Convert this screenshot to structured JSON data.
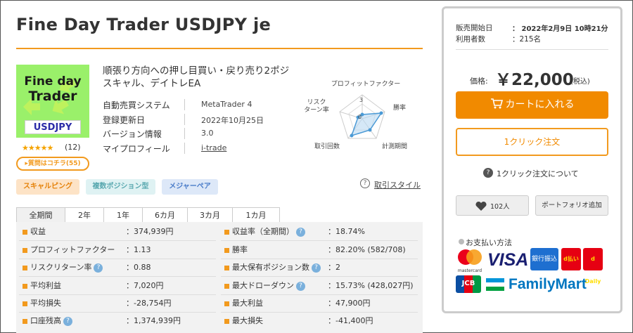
{
  "title": "Fine Day Trader USDJPY je",
  "logo": {
    "line1": "Fine day",
    "line2": "Trader",
    "badge": "USDJPY"
  },
  "rating": {
    "stars": "★★★★★",
    "count": "(12)"
  },
  "qa_button": "▸質問はコチラ(55)",
  "catchcopy": "順張り方向への押し目買い・戻り売り2ポジスキャル、デイトレEA",
  "info": [
    {
      "label": "自動売買システム",
      "value": "MetaTrader 4"
    },
    {
      "label": "登録更新日",
      "value": "2022年10月25日"
    },
    {
      "label": "バージョン情報",
      "value": "3.0"
    },
    {
      "label": "マイプロフィール",
      "value": "i-trade"
    }
  ],
  "radar": {
    "labels": {
      "top": "プロフィットファクター",
      "right_top": "勝率",
      "right_bottom": "計測期間",
      "left_bottom": "取引回数",
      "left_top": "リスク\nターン率"
    },
    "scale_top": "3",
    "scale_center": "0"
  },
  "tags": [
    {
      "label": "スキャルピング",
      "bg": "#fde3c6",
      "color": "#e5820a"
    },
    {
      "label": "複数ポジション型",
      "bg": "#dff2f3",
      "color": "#5aa9b0"
    },
    {
      "label": "メジャーペア",
      "bg": "#dde8f8",
      "color": "#4a7cc9"
    }
  ],
  "risk_style": "取引スタイル",
  "tabs": [
    "全期間",
    "2年",
    "1年",
    "6カ月",
    "3カ月",
    "1カ月"
  ],
  "stats_left": [
    {
      "label": "収益",
      "value": "：374,939円",
      "help": false
    },
    {
      "label": "プロフィットファクター",
      "value": "：1.13",
      "help": false
    },
    {
      "label": "リスクリターン率",
      "value": "：0.88",
      "help": true
    },
    {
      "label": "平均利益",
      "value": "：7,020円",
      "help": false
    },
    {
      "label": "平均損失",
      "value": "：-28,754円",
      "help": false
    },
    {
      "label": "口座残高",
      "value": "：1,374,939円",
      "help": true
    }
  ],
  "stats_right": [
    {
      "label": "収益率（全期間）",
      "value": "：18.74%",
      "help": true
    },
    {
      "label": "勝率",
      "value": "：82.20% (582/708)",
      "help": false
    },
    {
      "label": "最大保有ポジション数",
      "value": "：2",
      "help": true
    },
    {
      "label": "最大ドローダウン",
      "value": "：15.73% (428,027円)",
      "help": true
    },
    {
      "label": "最大利益",
      "value": "：47,900円",
      "help": false
    },
    {
      "label": "最大損失",
      "value": "：-41,400円",
      "help": false
    }
  ],
  "sidebar": {
    "release_label": "販売開始日",
    "release_value": "：  2022年2月9日  10時21分",
    "users_label": "利用者数",
    "users_value": "：215名",
    "price_label": "価格:",
    "price_value": "￥22,000",
    "price_tax": "(税込)",
    "cart_label": "カートに入れる",
    "oneclick_label": "1クリック注文",
    "oneclick_about": "1クリック注文について",
    "fav_count": "102人",
    "portfolio_label": "ポートフォリオ追加",
    "pay_title": "お支払い方法",
    "payment_methods": [
      "mastercard",
      "VISA",
      "銀行振込",
      "d払い",
      "d Daily",
      "JCB",
      "FamilyMart"
    ]
  },
  "colors": {
    "accent": "#f29a1e",
    "cart": "#f18a00",
    "logo_bg": "#9af06a"
  }
}
